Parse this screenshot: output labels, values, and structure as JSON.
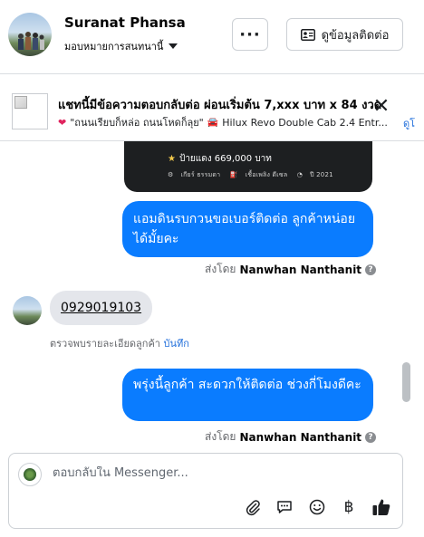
{
  "header": {
    "name": "Suranat Phansa",
    "assign_label": "มอบหมายการสนทนานี้",
    "more_label": "···",
    "contact_label": "ดูข้อมูลติดต่อ"
  },
  "ad": {
    "title": "แชทนี้มีข้อความตอบกลับต่อ ผ่อนเริ่มต้น 7,xxx บาท x 84 งวด",
    "subtitle_quote": "\"ถนนเรียบก็หล่อ ถนนโหดก็ลุย\"",
    "subtitle_product": "Hilux Revo Double Cab 2.4 Entr...",
    "link": "ดูโ",
    "close_label": "✕"
  },
  "image_message": {
    "price": "ป้ายแดง 669,000 บาท",
    "meta": [
      "เกียร์ ธรรมดา",
      "เชื้อเพลิง ดีเซล",
      "ปี 2021"
    ]
  },
  "messages": {
    "outgoing_1": "แอมดินรบกวนขอเบอร์ติดต่อ ลูกค้าหน่อยได้มั้ยคะ",
    "sent_by_prefix": "ส่งโดย",
    "sent_by_name": "Nanwhan Nanthanit",
    "incoming_phone": "0929019103",
    "note_text": "ตรวจพบรายละเอียดลูกค้า",
    "note_link": "บันทึก",
    "outgoing_2": "พรุ่งนี้ลูกค้า  สะดวกให้ติดต่อ ช่วงกี่โมงดีคะ"
  },
  "composer": {
    "placeholder": "ตอบกลับใน Messenger...",
    "currency_symbol": "฿"
  }
}
